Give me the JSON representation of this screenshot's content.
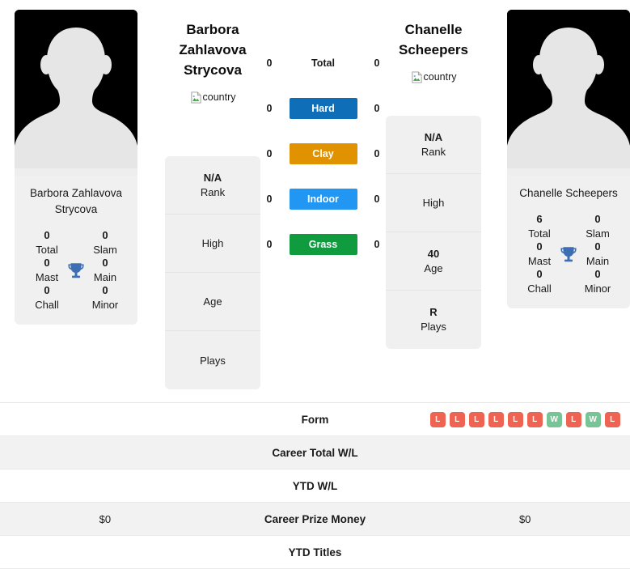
{
  "players": {
    "left": {
      "name": "Barbora Zahlavova Strycova",
      "name_lines": [
        "Barbora",
        "Zahlavova",
        "Strycova"
      ],
      "card_name": "Barbora Zahlavova Strycova",
      "country_alt": "country",
      "titles": {
        "total": "0",
        "total_label": "Total",
        "slam": "0",
        "slam_label": "Slam",
        "mast": "0",
        "mast_label": "Mast",
        "main": "0",
        "main_label": "Main",
        "chall": "0",
        "chall_label": "Chall",
        "minor": "0",
        "minor_label": "Minor"
      },
      "info": [
        {
          "value": "N/A",
          "label": "Rank"
        },
        {
          "value": "",
          "label": "High"
        },
        {
          "value": "",
          "label": "Age"
        },
        {
          "value": "",
          "label": "Plays"
        }
      ]
    },
    "right": {
      "name": "Chanelle Scheepers",
      "name_lines": [
        "Chanelle",
        "Scheepers"
      ],
      "card_name": "Chanelle Scheepers",
      "country_alt": "country",
      "titles": {
        "total": "6",
        "total_label": "Total",
        "slam": "0",
        "slam_label": "Slam",
        "mast": "0",
        "mast_label": "Mast",
        "main": "0",
        "main_label": "Main",
        "chall": "0",
        "chall_label": "Chall",
        "minor": "0",
        "minor_label": "Minor"
      },
      "info": [
        {
          "value": "N/A",
          "label": "Rank"
        },
        {
          "value": "",
          "label": "High"
        },
        {
          "value": "40",
          "label": "Age"
        },
        {
          "value": "R",
          "label": "Plays"
        }
      ]
    }
  },
  "surfaces": [
    {
      "label": "Total",
      "left": "0",
      "right": "0",
      "color": "transparent",
      "text_color": "#1a1a1a"
    },
    {
      "label": "Hard",
      "left": "0",
      "right": "0",
      "color": "#0e6eb8",
      "text_color": "#ffffff"
    },
    {
      "label": "Clay",
      "left": "0",
      "right": "0",
      "color": "#e09200",
      "text_color": "#ffffff"
    },
    {
      "label": "Indoor",
      "left": "0",
      "right": "0",
      "color": "#2196f3",
      "text_color": "#ffffff"
    },
    {
      "label": "Grass",
      "left": "0",
      "right": "0",
      "color": "#0f9b3e",
      "text_color": "#ffffff"
    }
  ],
  "stat_rows": [
    {
      "label": "Form",
      "left_value": "",
      "right_value": "",
      "left_form": [],
      "right_form": [
        "L",
        "L",
        "L",
        "L",
        "L",
        "L",
        "W",
        "L",
        "W",
        "L"
      ]
    },
    {
      "label": "Career Total W/L",
      "left_value": "",
      "right_value": "",
      "left_form": [],
      "right_form": []
    },
    {
      "label": "YTD W/L",
      "left_value": "",
      "right_value": "",
      "left_form": [],
      "right_form": []
    },
    {
      "label": "Career Prize Money",
      "left_value": "$0",
      "right_value": "$0",
      "left_form": [],
      "right_form": []
    },
    {
      "label": "YTD Titles",
      "left_value": "",
      "right_value": "",
      "left_form": [],
      "right_form": []
    }
  ],
  "colors": {
    "win": "#77c496",
    "loss": "#ee6352",
    "card_bg": "#f0f0f0",
    "trophy": "#3d6eb4"
  }
}
